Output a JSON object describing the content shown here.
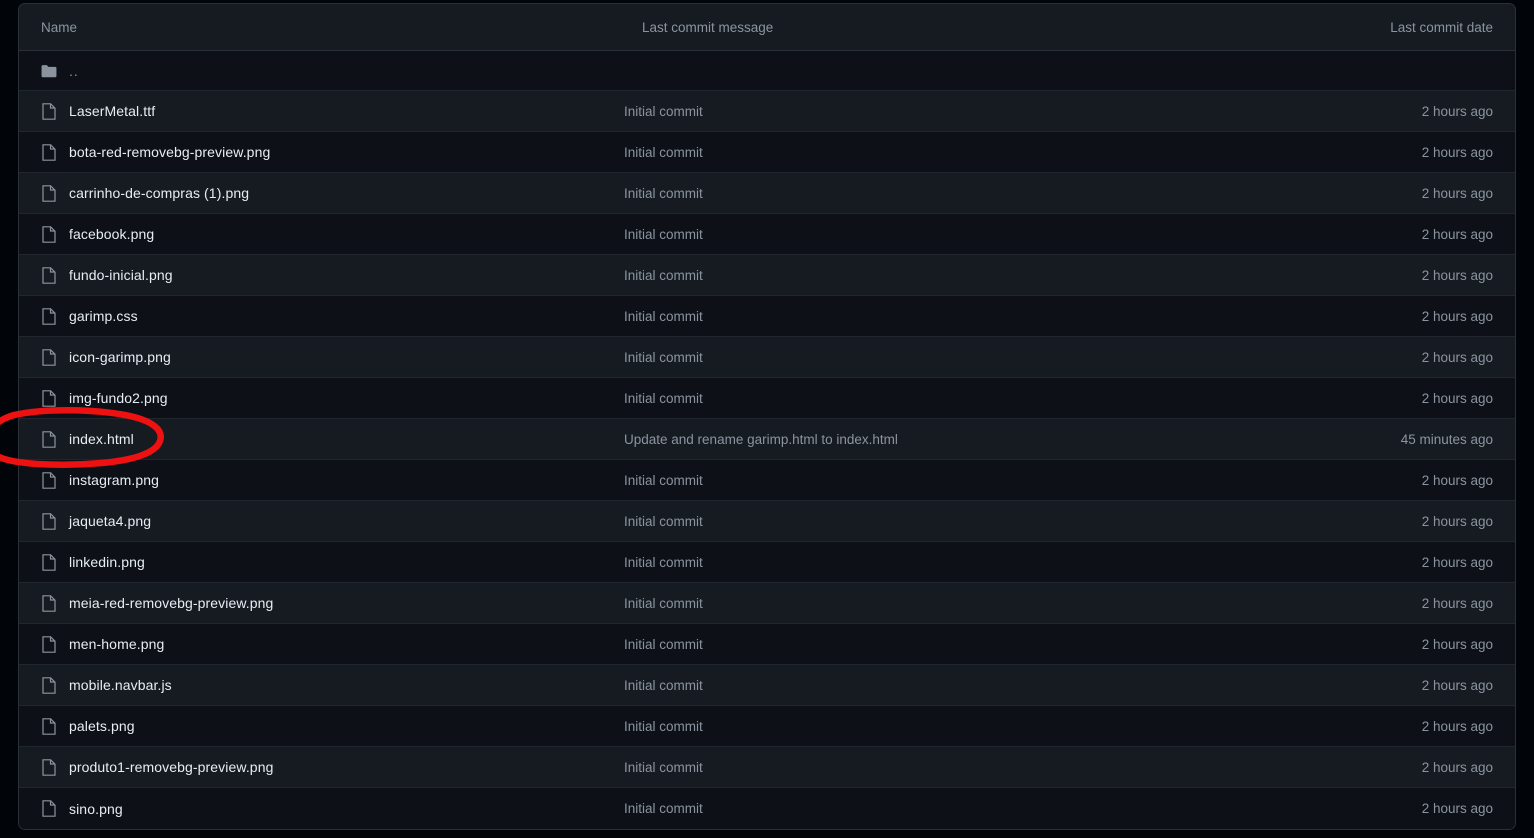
{
  "theme": {
    "page_background": "#010409",
    "table_background": "#0d1117",
    "row_alt_background": "#161b22",
    "border_color": "#2a3038",
    "text_primary": "#e6edf3",
    "text_muted": "#8b949e",
    "annotation_color": "#ee1111"
  },
  "table": {
    "columns": {
      "name": "Name",
      "message": "Last commit message",
      "date": "Last commit date"
    },
    "parent_row": {
      "label": "..",
      "icon": "folder-icon",
      "message": "",
      "date": ""
    },
    "rows": [
      {
        "name": "LaserMetal.ttf",
        "icon": "file-icon",
        "message": "Initial commit",
        "date": "2 hours ago"
      },
      {
        "name": "bota-red-removebg-preview.png",
        "icon": "file-icon",
        "message": "Initial commit",
        "date": "2 hours ago"
      },
      {
        "name": "carrinho-de-compras (1).png",
        "icon": "file-icon",
        "message": "Initial commit",
        "date": "2 hours ago"
      },
      {
        "name": "facebook.png",
        "icon": "file-icon",
        "message": "Initial commit",
        "date": "2 hours ago"
      },
      {
        "name": "fundo-inicial.png",
        "icon": "file-icon",
        "message": "Initial commit",
        "date": "2 hours ago"
      },
      {
        "name": "garimp.css",
        "icon": "file-icon",
        "message": "Initial commit",
        "date": "2 hours ago"
      },
      {
        "name": "icon-garimp.png",
        "icon": "file-icon",
        "message": "Initial commit",
        "date": "2 hours ago"
      },
      {
        "name": "img-fundo2.png",
        "icon": "file-icon",
        "message": "Initial commit",
        "date": "2 hours ago"
      },
      {
        "name": "index.html",
        "icon": "file-icon",
        "message": "Update and rename garimp.html to index.html",
        "date": "45 minutes ago",
        "annotated": true
      },
      {
        "name": "instagram.png",
        "icon": "file-icon",
        "message": "Initial commit",
        "date": "2 hours ago"
      },
      {
        "name": "jaqueta4.png",
        "icon": "file-icon",
        "message": "Initial commit",
        "date": "2 hours ago"
      },
      {
        "name": "linkedin.png",
        "icon": "file-icon",
        "message": "Initial commit",
        "date": "2 hours ago"
      },
      {
        "name": "meia-red-removebg-preview.png",
        "icon": "file-icon",
        "message": "Initial commit",
        "date": "2 hours ago"
      },
      {
        "name": "men-home.png",
        "icon": "file-icon",
        "message": "Initial commit",
        "date": "2 hours ago"
      },
      {
        "name": "mobile.navbar.js",
        "icon": "file-icon",
        "message": "Initial commit",
        "date": "2 hours ago"
      },
      {
        "name": "palets.png",
        "icon": "file-icon",
        "message": "Initial commit",
        "date": "2 hours ago"
      },
      {
        "name": "produto1-removebg-preview.png",
        "icon": "file-icon",
        "message": "Initial commit",
        "date": "2 hours ago"
      },
      {
        "name": "sino.png",
        "icon": "file-icon",
        "message": "Initial commit",
        "date": "2 hours ago"
      }
    ]
  },
  "annotation": {
    "shape": "hand-drawn-ellipse",
    "targets": "index.html"
  }
}
